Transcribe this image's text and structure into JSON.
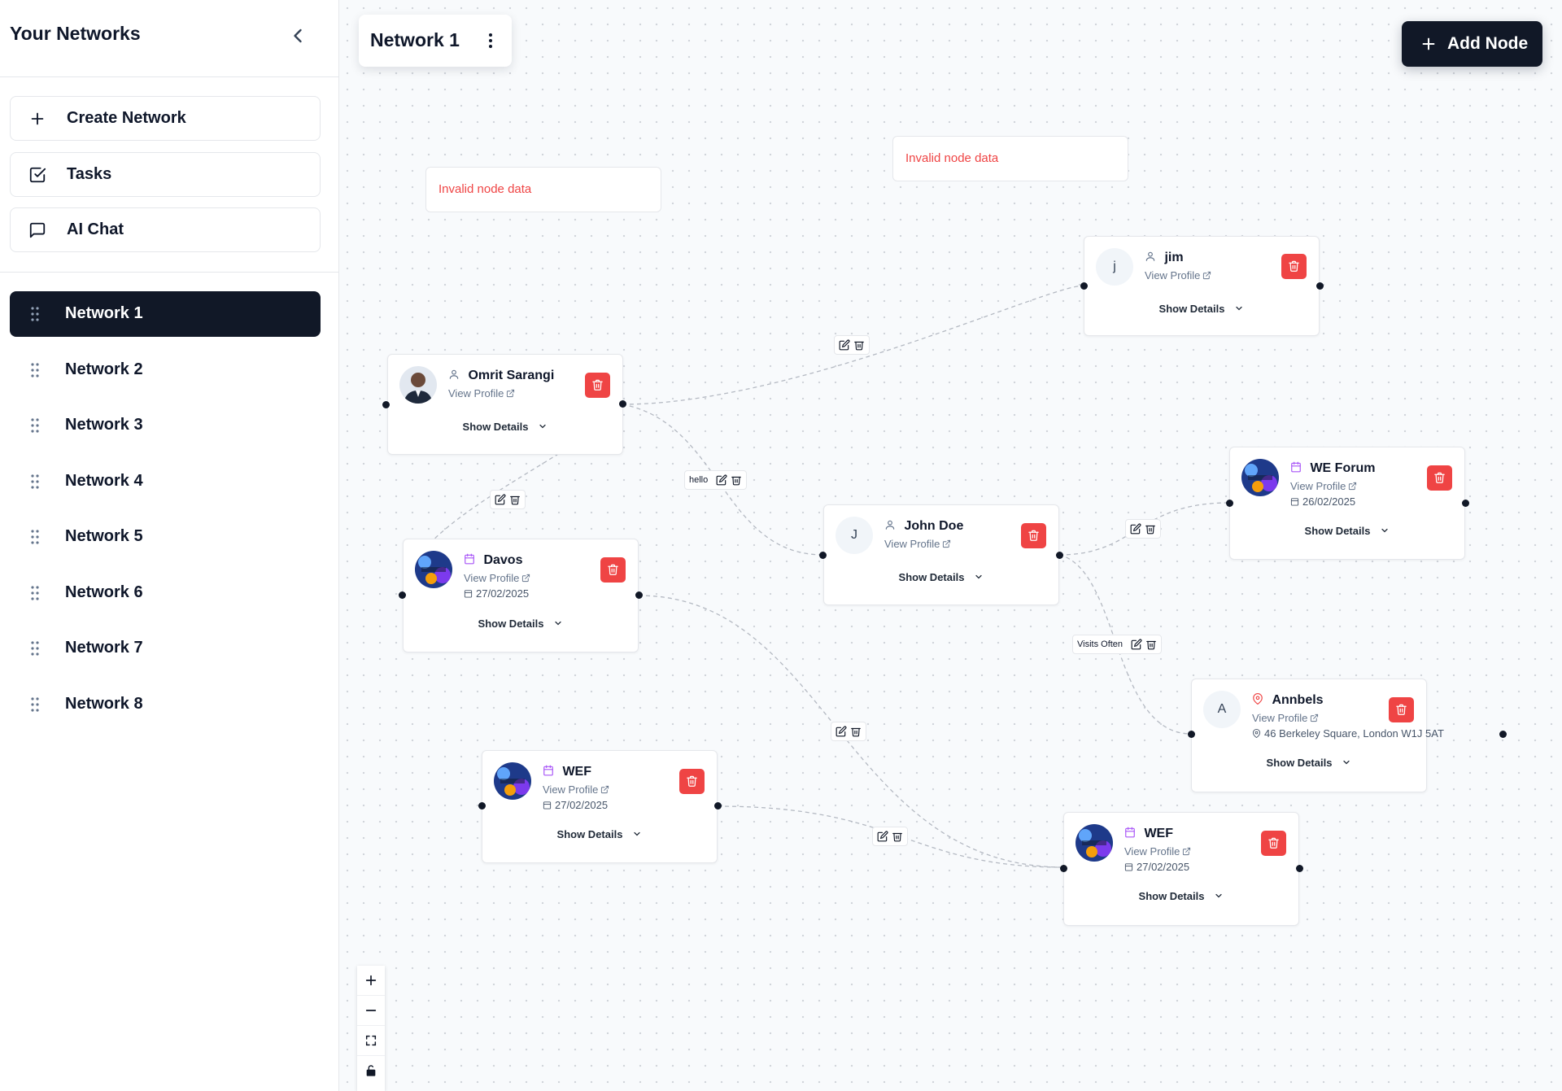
{
  "sidebar": {
    "title": "Your Networks",
    "actions": [
      {
        "label": "Create Network",
        "icon": "plus-icon"
      },
      {
        "label": "Tasks",
        "icon": "checkbox-icon"
      },
      {
        "label": "AI Chat",
        "icon": "chat-icon"
      }
    ],
    "networks": [
      {
        "label": "Network 1",
        "active": true
      },
      {
        "label": "Network 2",
        "active": false
      },
      {
        "label": "Network 3",
        "active": false
      },
      {
        "label": "Network 4",
        "active": false
      },
      {
        "label": "Network 5",
        "active": false
      },
      {
        "label": "Network 6",
        "active": false
      },
      {
        "label": "Network 7",
        "active": false
      },
      {
        "label": "Network 8",
        "active": false
      }
    ]
  },
  "canvas": {
    "network_title": "Network 1",
    "add_node_label": "Add Node",
    "invalid_text": "Invalid node data",
    "view_profile_label": "View Profile",
    "show_details_label": "Show Details",
    "nodes": [
      {
        "name": "jim",
        "type": "person",
        "avatar": "j"
      },
      {
        "name": "Omrit Sarangi",
        "type": "person",
        "avatar": "photo"
      },
      {
        "name": "Davos",
        "type": "event",
        "avatar": "photo",
        "date": "27/02/2025"
      },
      {
        "name": "John Doe",
        "type": "person",
        "avatar": "J"
      },
      {
        "name": "WE Forum",
        "type": "event",
        "avatar": "photo",
        "date": "26/02/2025"
      },
      {
        "name": "Annbels",
        "type": "place",
        "avatar": "A",
        "address": "46 Berkeley Square, London W1J 5AT"
      },
      {
        "name": "WEF",
        "type": "event",
        "avatar": "photo",
        "date": "27/02/2025"
      },
      {
        "name": "WEF",
        "type": "event",
        "avatar": "photo",
        "date": "27/02/2025"
      }
    ],
    "edge_labels": [
      "hello",
      "Visits Often"
    ]
  },
  "colors": {
    "primary_dark": "#111827",
    "danger": "#ef4444",
    "event_icon": "#a855f7",
    "place_icon": "#ef4444"
  }
}
